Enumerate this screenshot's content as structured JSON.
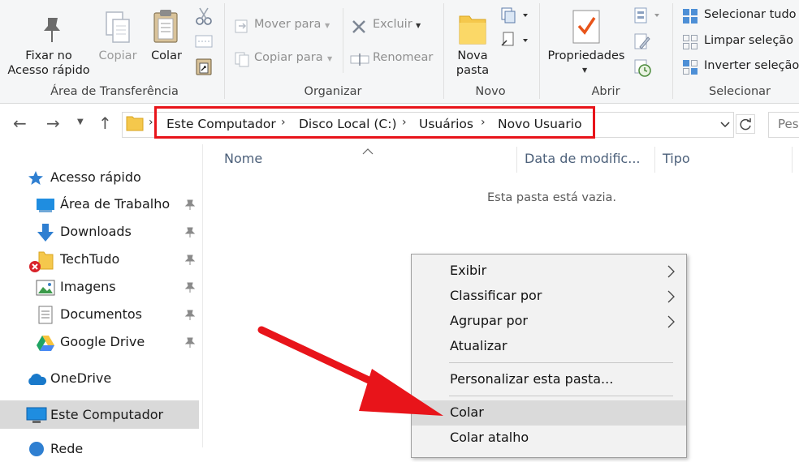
{
  "ribbon": {
    "clipboard": {
      "group_label": "Área de Transferência",
      "pin_label_1": "Fixar no",
      "pin_label_2": "Acesso rápido",
      "copy_label": "Copiar",
      "paste_label": "Colar"
    },
    "organize": {
      "group_label": "Organizar",
      "move_label": "Mover para",
      "copy_to_label": "Copiar para",
      "delete_label": "Excluir",
      "rename_label": "Renomear"
    },
    "new": {
      "group_label": "Novo",
      "new_folder_1": "Nova",
      "new_folder_2": "pasta"
    },
    "open": {
      "group_label": "Abrir",
      "properties_label": "Propriedades"
    },
    "select": {
      "group_label": "Selecionar",
      "select_all": "Selecionar tudo",
      "clear_selection": "Limpar seleção",
      "invert_selection": "Inverter seleção"
    }
  },
  "address": {
    "crumbs": [
      "Este Computador",
      "Disco Local (C:)",
      "Usuários",
      "Novo Usuario"
    ],
    "separator": "›",
    "search_placeholder": "Pes"
  },
  "sidebar": {
    "quick_access": "Acesso rápido",
    "items": [
      {
        "label": "Área de Trabalho",
        "icon": "desktop-icon"
      },
      {
        "label": "Downloads",
        "icon": "download-icon"
      },
      {
        "label": "TechTudo",
        "icon": "folder-error-icon"
      },
      {
        "label": "Imagens",
        "icon": "pictures-icon"
      },
      {
        "label": "Documentos",
        "icon": "documents-icon"
      },
      {
        "label": "Google Drive",
        "icon": "google-drive-icon"
      }
    ],
    "onedrive": "OneDrive",
    "this_pc": "Este Computador",
    "network": "Rede"
  },
  "content": {
    "columns": [
      "Nome",
      "Data de modific...",
      "Tipo"
    ],
    "empty_message": "Esta pasta está vazia."
  },
  "context_menu": {
    "items": [
      "Exibir",
      "Classificar por",
      "Agrupar por",
      "Atualizar",
      "Personalizar esta pasta...",
      "Colar",
      "Colar atalho"
    ],
    "highlighted": "Colar"
  },
  "colors": {
    "accent_red": "#e8141a",
    "folder_yellow": "#f5c84c",
    "windows_blue": "#1979ca"
  }
}
